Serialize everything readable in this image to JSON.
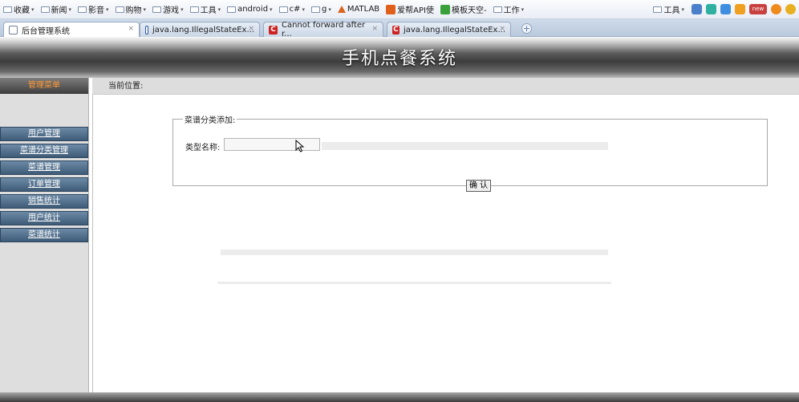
{
  "browser": {
    "bookmarks": [
      {
        "label": "收藏",
        "kind": "folder"
      },
      {
        "label": "新闻",
        "kind": "folder"
      },
      {
        "label": "影音",
        "kind": "folder"
      },
      {
        "label": "购物",
        "kind": "folder"
      },
      {
        "label": "游戏",
        "kind": "folder"
      },
      {
        "label": "工具",
        "kind": "folder"
      },
      {
        "label": "android",
        "kind": "folder"
      },
      {
        "label": "c#",
        "kind": "folder"
      },
      {
        "label": "g",
        "kind": "folder"
      },
      {
        "label": "MATLAB",
        "kind": "link"
      },
      {
        "label": "爱帮API使",
        "kind": "link"
      },
      {
        "label": "模板天空-",
        "kind": "link"
      },
      {
        "label": "工作",
        "kind": "folder"
      }
    ],
    "toolbar_right": {
      "tools_label": "工具",
      "new_badge": "new"
    },
    "tabs": [
      {
        "title": "后台管理系统",
        "active": true
      },
      {
        "title": "java.lang.IllegalStateEx...",
        "active": false
      },
      {
        "title": "Cannot forward after r...",
        "active": false
      },
      {
        "title": "java.lang.IllegalStateEx...",
        "active": false
      }
    ],
    "tab_close_glyph": "×",
    "new_tab_glyph": "+"
  },
  "app": {
    "title": "手机点餐系统",
    "sidebar": {
      "heading": "管理菜单",
      "items": [
        "用户管理",
        "菜谱分类管理",
        "菜谱管理",
        "订单管理",
        "销售统计",
        "用户统计",
        "菜谱统计"
      ]
    },
    "breadcrumb": "当前位置:",
    "form": {
      "legend": "菜谱分类添加:",
      "type_name_label": "类型名称:",
      "type_name_value": "",
      "submit_label": "确 认"
    }
  },
  "colors": {
    "menu_heading_text": "#ff9933",
    "menu_item_bg": "#4f6c88",
    "header_dark": "#3c3c3c"
  }
}
